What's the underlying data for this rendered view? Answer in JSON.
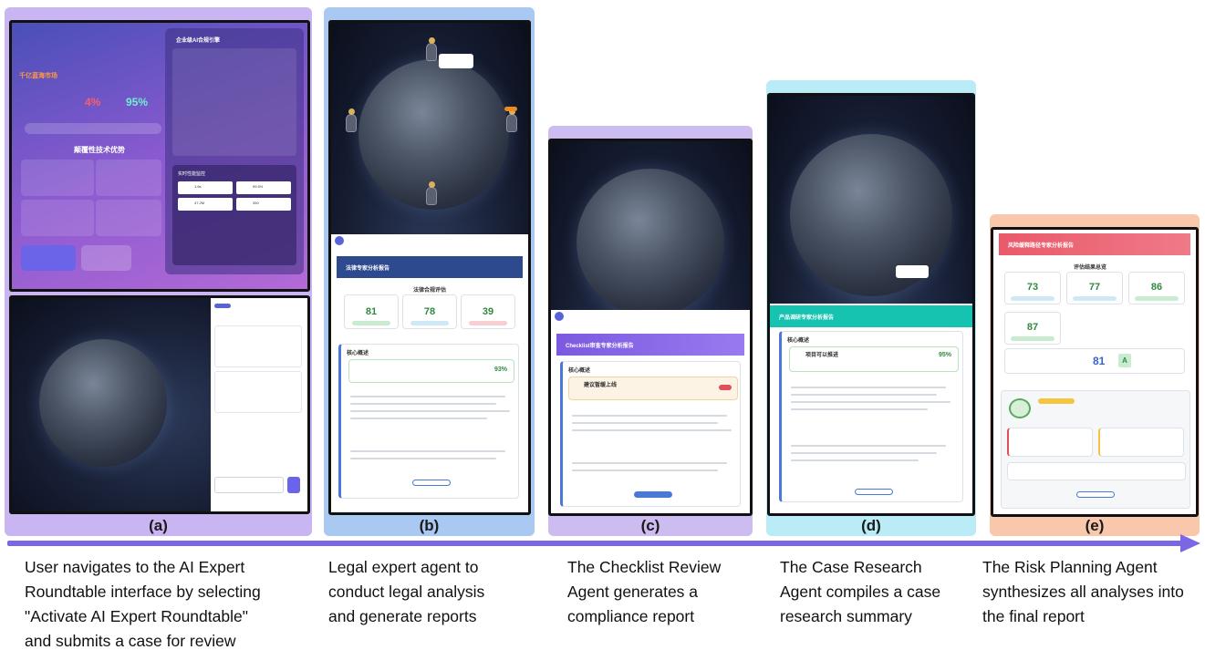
{
  "steps": [
    {
      "letter": "(a)",
      "caption_lines": [
        "User navigates to the AI Expert",
        "Roundtable interface by selecting",
        "\"Activate AI Expert Roundtable\"",
        "and submits a case for review"
      ],
      "ui": {
        "hero_heading": "千亿蓝海市场",
        "stats": [
          "4%",
          "95%"
        ],
        "section_title": "颠覆性技术优势",
        "engine_title": "企业级AI合规引擎",
        "monitor_title": "实时性能监控",
        "monitor_values": [
          "1.6s",
          "99.5%",
          "47.2M",
          "350"
        ]
      }
    },
    {
      "letter": "(b)",
      "caption_lines": [
        "Legal expert agent to",
        "conduct legal analysis",
        "and generate reports"
      ],
      "ui": {
        "report_title": "法律专家分析报告",
        "section_title": "法律合规评估",
        "scores": [
          "81",
          "78",
          "39"
        ],
        "core_title": "核心概述",
        "core_pct": "93%"
      }
    },
    {
      "letter": "(c)",
      "caption_lines": [
        "The Checklist Review",
        "Agent generates a",
        "compliance report"
      ],
      "ui": {
        "report_title": "Checklist审查专家分析报告",
        "core_title": "核心概述",
        "alert_title": "建议暂缓上线"
      }
    },
    {
      "letter": "(d)",
      "caption_lines": [
        "The Case Research",
        "Agent compiles a case",
        "research summary"
      ],
      "ui": {
        "report_title": "产品调研专家分析报告",
        "core_title": "核心概述",
        "core_item": "项目可以推进",
        "core_pct": "95%"
      }
    },
    {
      "letter": "(e)",
      "caption_lines": [
        "The Risk Planning Agent",
        "synthesizes all analyses into",
        "the final report"
      ],
      "ui": {
        "report_title": "风险缓释路径专家分析报告",
        "section_title": "评估结果总览",
        "scores": [
          "73",
          "77",
          "86",
          "87"
        ],
        "total_score": "81",
        "grade": "A"
      }
    }
  ],
  "colors": {
    "a": "#c9b5f2",
    "b": "#a9c9f2",
    "c": "#cdbcf0",
    "d": "#b9ecf7",
    "e": "#f9c8ac",
    "timeline": "#7b66e6"
  }
}
